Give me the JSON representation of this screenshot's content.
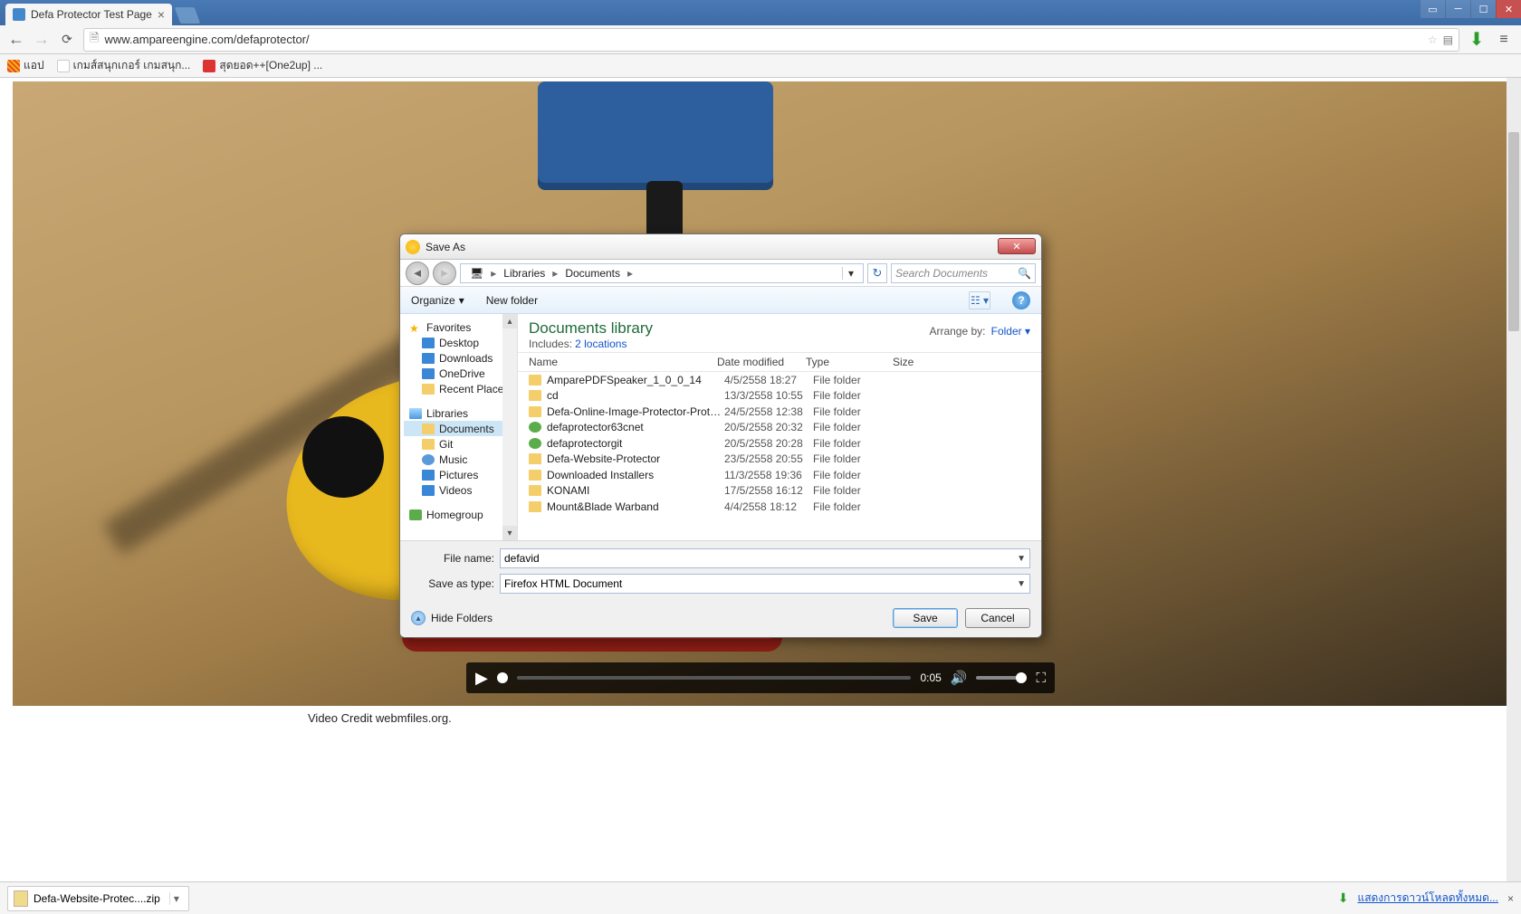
{
  "browser": {
    "tab_title": "Defa Protector Test Page",
    "url": "www.ampareengine.com/defaprotector/",
    "bookmarks": [
      "แอป",
      "เกมส์สนุกเกอร์ เกมสนุก...",
      "สุดยอด++[One2up] ..."
    ]
  },
  "video": {
    "time": "0:05",
    "credit": "Video Credit webmfiles.org."
  },
  "download_shelf": {
    "item": "Defa-Website-Protec....zip",
    "link": "แสดงการดาวน์โหลดทั้งหมด..."
  },
  "saveas": {
    "title": "Save As",
    "breadcrumb": [
      "Libraries",
      "Documents"
    ],
    "search_placeholder": "Search Documents",
    "organize": "Organize",
    "new_folder": "New folder",
    "tree": {
      "favorites": "Favorites",
      "fav_items": [
        "Desktop",
        "Downloads",
        "OneDrive",
        "Recent Places"
      ],
      "libraries": "Libraries",
      "lib_items": [
        "Documents",
        "Git",
        "Music",
        "Pictures",
        "Videos"
      ],
      "homegroup": "Homegroup"
    },
    "pane": {
      "title": "Documents library",
      "includes_label": "Includes:",
      "includes_link": "2 locations",
      "arrange_label": "Arrange by:",
      "arrange_value": "Folder",
      "cols": {
        "name": "Name",
        "modified": "Date modified",
        "type": "Type",
        "size": "Size"
      },
      "rows": [
        {
          "name": "AmparePDFSpeaker_1_0_0_14",
          "mod": "4/5/2558 18:27",
          "type": "File folder",
          "icon": "folder"
        },
        {
          "name": "cd",
          "mod": "13/3/2558 10:55",
          "type": "File folder",
          "icon": "folder"
        },
        {
          "name": "Defa-Online-Image-Protector-Protect-I...",
          "mod": "24/5/2558 12:38",
          "type": "File folder",
          "icon": "folder"
        },
        {
          "name": "defaprotector63cnet",
          "mod": "20/5/2558 20:32",
          "type": "File folder",
          "icon": "sync"
        },
        {
          "name": "defaprotectorgit",
          "mod": "20/5/2558 20:28",
          "type": "File folder",
          "icon": "sync"
        },
        {
          "name": "Defa-Website-Protector",
          "mod": "23/5/2558 20:55",
          "type": "File folder",
          "icon": "folder"
        },
        {
          "name": "Downloaded Installers",
          "mod": "11/3/2558 19:36",
          "type": "File folder",
          "icon": "folder"
        },
        {
          "name": "KONAMI",
          "mod": "17/5/2558 16:12",
          "type": "File folder",
          "icon": "folder"
        },
        {
          "name": "Mount&Blade Warband",
          "mod": "4/4/2558 18:12",
          "type": "File folder",
          "icon": "folder"
        }
      ]
    },
    "filename_label": "File name:",
    "filename_value": "defavid",
    "saveastype_label": "Save as type:",
    "saveastype_value": "Firefox HTML Document",
    "hide_folders": "Hide Folders",
    "save": "Save",
    "cancel": "Cancel"
  }
}
